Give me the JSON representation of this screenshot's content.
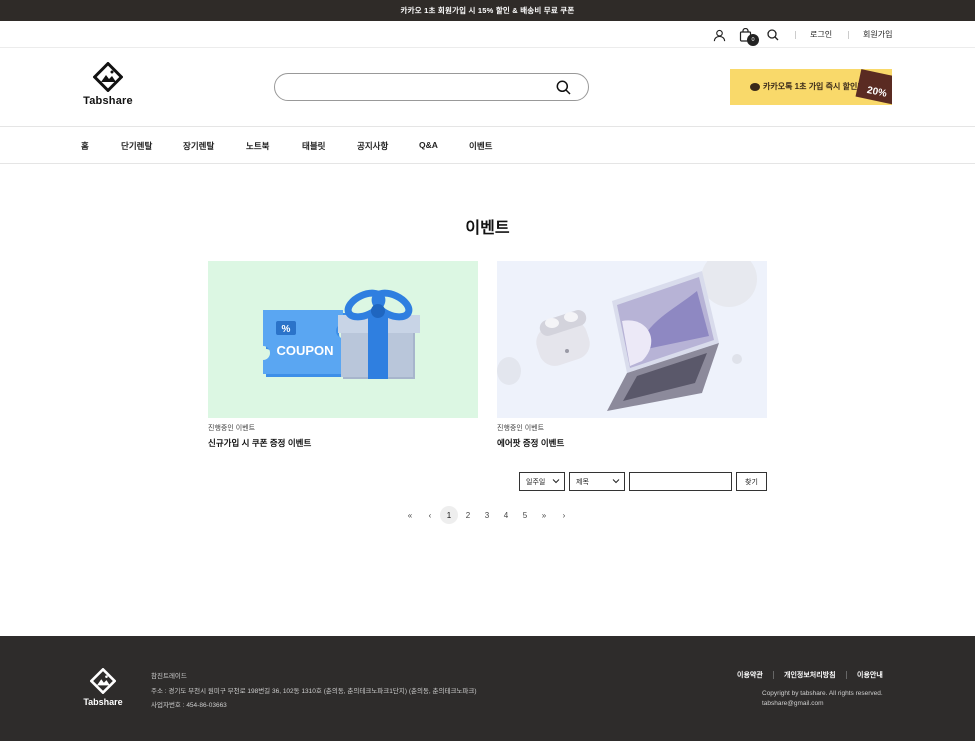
{
  "promo": {
    "text": "카카오 1초 회원가입 시 15% 할인 & 배송비 무료 쿠폰"
  },
  "util": {
    "cart_count": "0",
    "login": "로그인",
    "signup": "회원가입"
  },
  "brand": {
    "name": "Tabshare"
  },
  "search": {
    "placeholder": ""
  },
  "kakao_banner": {
    "text": "카카오톡 1초 가입 즉시 할인!",
    "discount": "20%"
  },
  "nav": {
    "items": [
      {
        "label": "홈"
      },
      {
        "label": "단기렌탈"
      },
      {
        "label": "장기렌탈"
      },
      {
        "label": "노트북"
      },
      {
        "label": "태블릿"
      },
      {
        "label": "공지사항"
      },
      {
        "label": "Q&A"
      },
      {
        "label": "이벤트"
      }
    ]
  },
  "page": {
    "title": "이벤트"
  },
  "events": [
    {
      "status": "진행중인 이벤트",
      "title": "신규가입 시 쿠폰 증정 이벤트",
      "image_text": "COUPON"
    },
    {
      "status": "진행중인 이벤트",
      "title": "에어팟 증정 이벤트"
    }
  ],
  "filter": {
    "date_select": "일주일",
    "field_select": "제목",
    "search_value": "",
    "button": "찾기"
  },
  "pagination": {
    "first": "«",
    "prev": "‹",
    "pages": [
      "1",
      "2",
      "3",
      "4",
      "5"
    ],
    "current": "1",
    "next_group": "»",
    "next": "›"
  },
  "footer": {
    "company": "참진트레이드",
    "address": "주소 : 경기도 부천시 원미구 부천로 198번길 36, 102동 1310호 (춘의동, 춘의테크노파크1단지) (춘의동, 춘의테크노파크)",
    "business_no": "사업자번호 : 454-86-03663",
    "links": [
      "이용약관",
      "개인정보처리방침",
      "이용안내"
    ],
    "copyright": "Copyright by tabshare. All rights reserved.",
    "email": "tabshare@gmail.com"
  },
  "colors": {
    "promo_bg": "#2f2b28",
    "kakao_yellow": "#f9d96a",
    "footer_bg": "#2e2c2b",
    "coupon_bg": "#dcf7e3",
    "laptop_bg": "#eef2fb"
  }
}
